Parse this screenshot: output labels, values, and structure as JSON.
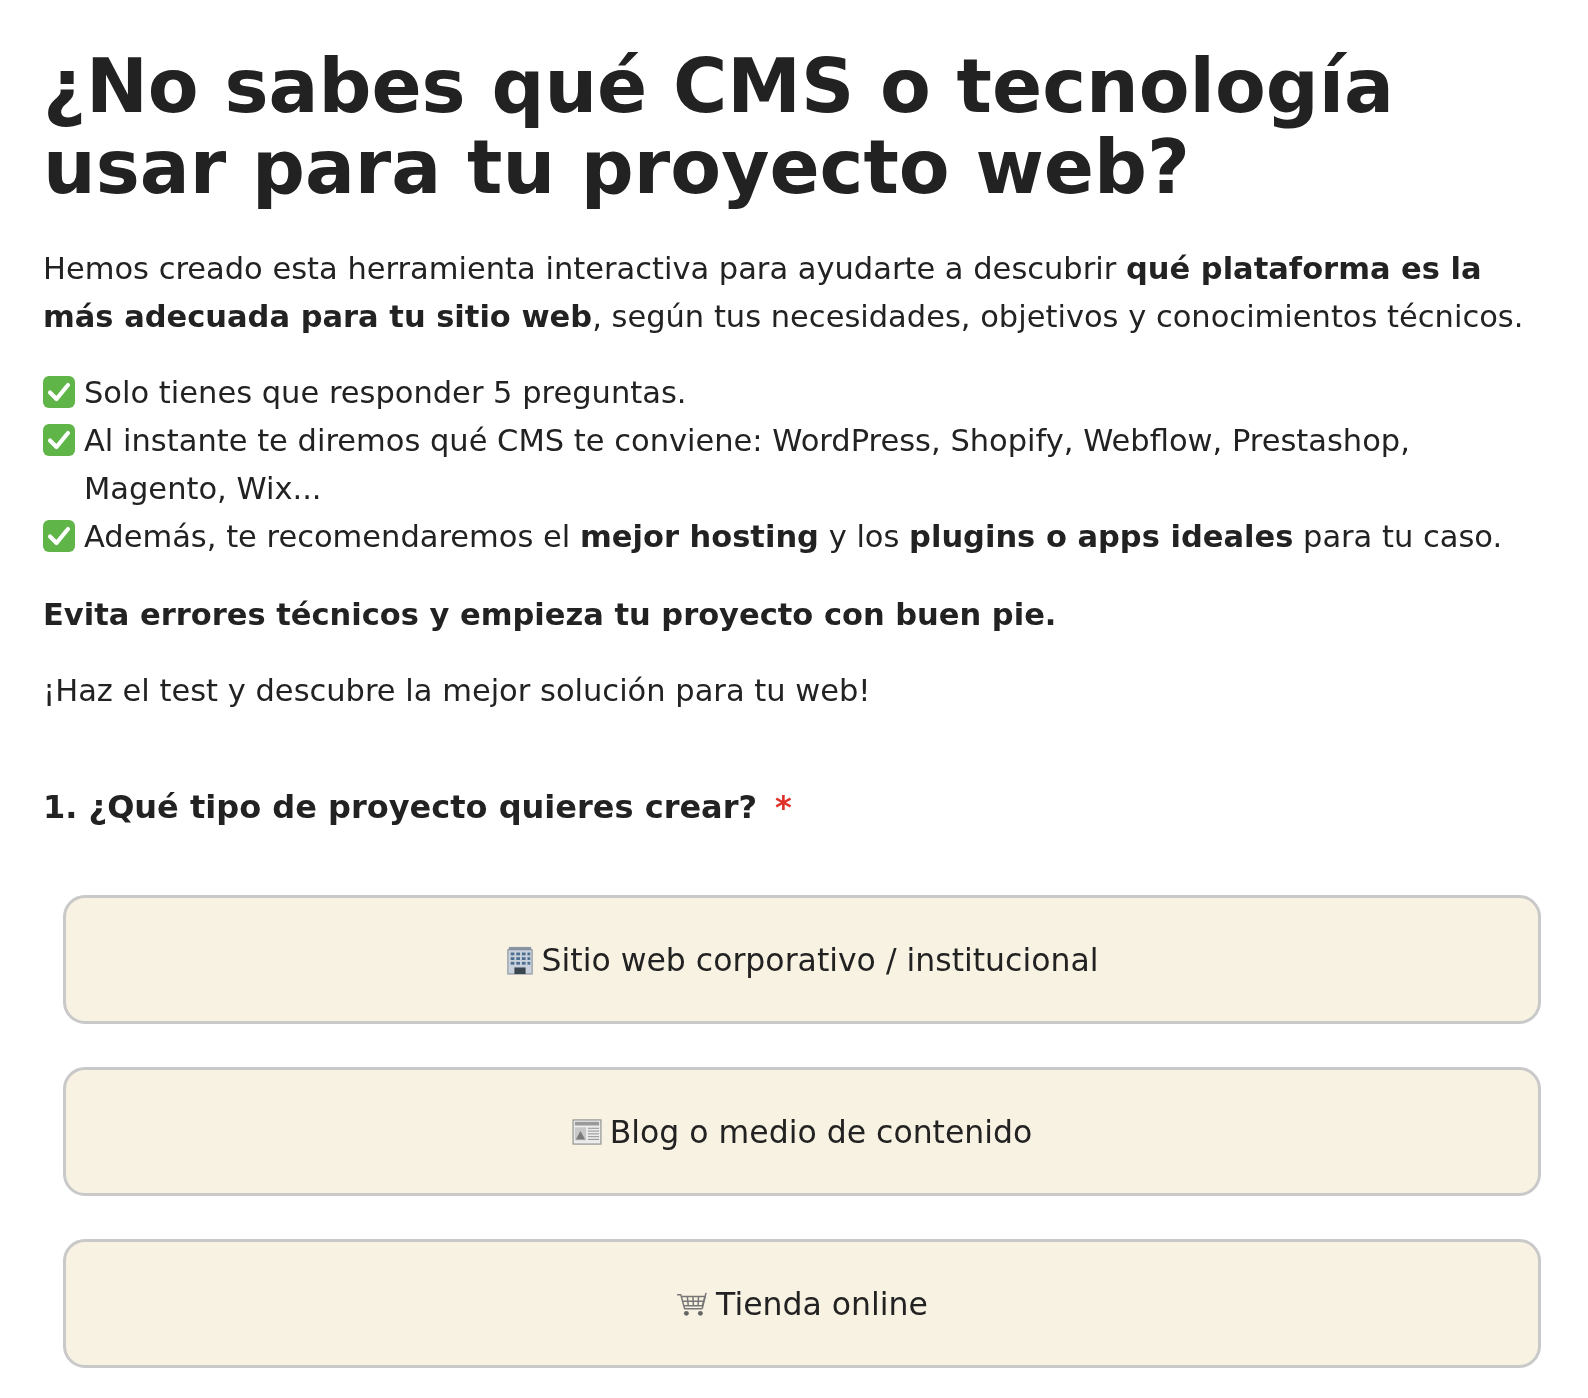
{
  "heading": "¿No sabes qué CMS o tecnología usar para tu proyecto web?",
  "intro": "Hemos creado esta herramienta interactiva para ayudarte a descubrir **qué plataforma es la más adecuada para tu sitio web**, según tus necesidades, objetivos y conocimientos técnicos.",
  "features": [
    {
      "text": "Solo tienes que responder 5 preguntas."
    },
    {
      "text": "Al instante te diremos qué CMS te conviene: WordPress, Shopify, Webflow, Prestashop, Magento, Wix..."
    },
    {
      "text": "Además, te recomendaremos el **mejor hosting** y los **plugins o apps ideales** para tu caso."
    }
  ],
  "tagline": "Evita errores técnicos y empieza tu proyecto con buen pie.",
  "call_to_action": "¡Haz el test y descubre la mejor solución para tu web!",
  "question": {
    "title": "1. ¿Qué tipo de proyecto quieres crear?",
    "required_mark": "*",
    "options": [
      {
        "label": "Sitio web corporativo / institucional",
        "selected": false
      },
      {
        "label": "Blog o medio de contenido",
        "selected": false
      },
      {
        "label": "Tienda online",
        "selected": false
      }
    ]
  }
}
